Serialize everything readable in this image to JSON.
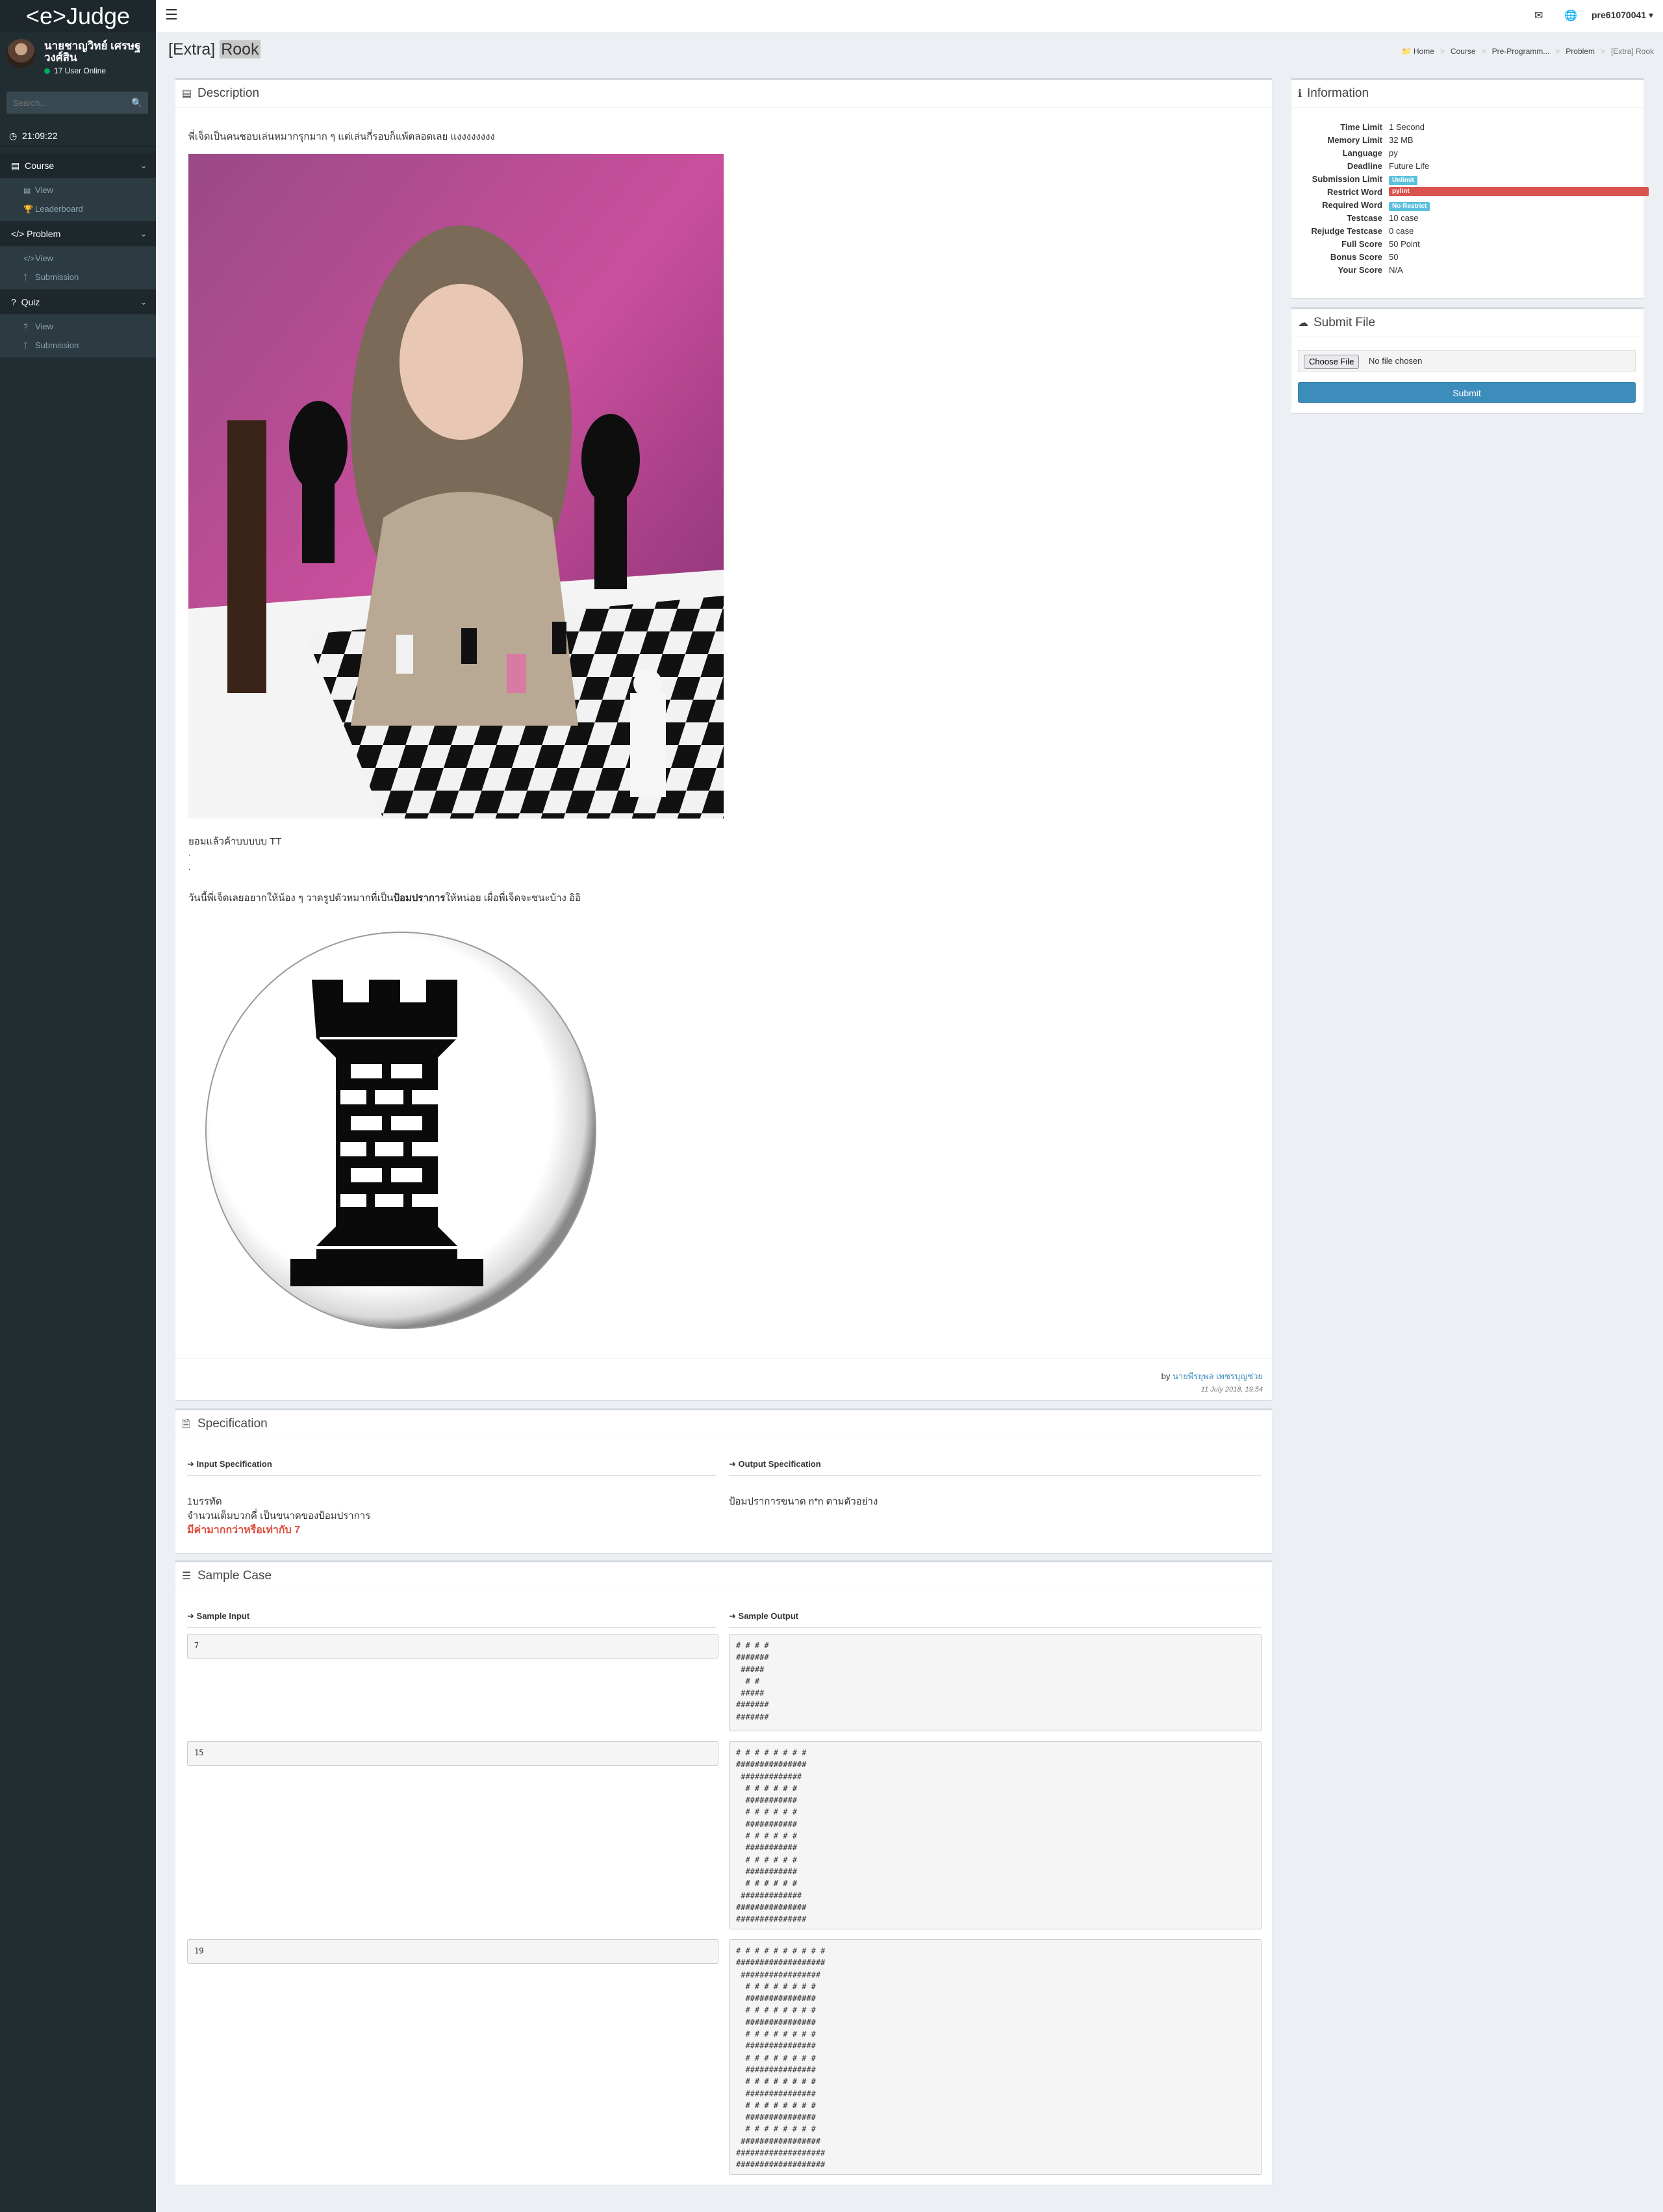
{
  "sidebar": {
    "brand": "<e>Judge",
    "user_name": "นายชาญวิทย์ เศรษฐวงศ์สิน",
    "online": "17 User Online",
    "search_placeholder": "Search...",
    "clock": "21:09:22",
    "sections": [
      {
        "label": "Course",
        "items": [
          {
            "label": "View"
          },
          {
            "label": "Leaderboard"
          }
        ]
      },
      {
        "label": "Problem",
        "items": [
          {
            "label": "View"
          },
          {
            "label": "Submission"
          }
        ]
      },
      {
        "label": "Quiz",
        "items": [
          {
            "label": "View"
          },
          {
            "label": "Submission"
          }
        ]
      }
    ]
  },
  "navbar": {
    "user": "pre61070041"
  },
  "page": {
    "title_prefix": "[Extra]",
    "title_highlight": "Rook"
  },
  "breadcrumb": [
    "Home",
    "Course",
    "Pre-Programm...",
    "Problem",
    "[Extra] Rook"
  ],
  "description": {
    "title": "Description",
    "p1": "พี่เจ็ดเป็นคนชอบเล่นหมากรุกมาก ๆ แต่เล่นกี่รอบก็แพ้ตลอดเลย แงงงงงงงง",
    "p2": "ยอมแล้วค้าบบบบบ TT",
    "dot1": ".",
    "dot2": ".",
    "p3_before": "วันนี้พี่เจ็ดเลยอยากให้น้อง ๆ วาดรูปตัวหมากที่เป็น",
    "p3_bold": "ป้อมปราการ",
    "p3_after": "ให้หน่อย เผื่อพี่เจ็ดจะชนะบ้าง อิอิ",
    "author_by": "by",
    "author_name": "นายพีรยุพล เพชรบุญช่วย",
    "date": "11 July 2018, 19:54"
  },
  "specification": {
    "title": "Specification",
    "input_title": "Input Specification",
    "output_title": "Output Specification",
    "input_line1": "1บรรทัด",
    "input_line2": "จำนวนเต็มบวกคี่ เป็นขนาดของป้อมปราการ",
    "input_line3": "มีค่ามากกว่าหรือเท่ากับ 7",
    "output_line1": "ป้อมปราการขนาด n*n ตามตัวอย่าง"
  },
  "samples": {
    "title": "Sample Case",
    "input_title": "Sample Input",
    "output_title": "Sample Output",
    "cases": [
      {
        "input": "7",
        "output": "# # # #\n#######\n #####\n  # #\n #####\n#######\n#######"
      },
      {
        "input": "15",
        "output": "# # # # # # # #\n###############\n #############\n  # # # # # #\n  ###########\n  # # # # # #\n  ###########\n  # # # # # #\n  ###########\n  # # # # # #\n  ###########\n  # # # # # #\n #############\n###############\n###############"
      },
      {
        "input": "19",
        "output": "# # # # # # # # # #\n###################\n #################\n  # # # # # # # #\n  ###############\n  # # # # # # # #\n  ###############\n  # # # # # # # #\n  ###############\n  # # # # # # # #\n  ###############\n  # # # # # # # #\n  ###############\n  # # # # # # # #\n  ###############\n  # # # # # # # #\n #################\n###################\n###################"
      }
    ]
  },
  "information": {
    "title": "Information",
    "rows": [
      {
        "key": "Time Limit",
        "value": "1 Second"
      },
      {
        "key": "Memory Limit",
        "value": "32 MB"
      },
      {
        "key": "Language",
        "value": "py"
      },
      {
        "key": "Deadline",
        "value": "Future Life"
      },
      {
        "key": "Submission Limit",
        "badge": "Unlimit"
      },
      {
        "key": "Restrict Word",
        "badge": "pylint"
      },
      {
        "key": "Required Word",
        "badge": "No Restrict"
      },
      {
        "key": "Testcase",
        "value": "10 case"
      },
      {
        "key": "Rejudge Testcase",
        "value": "0 case"
      },
      {
        "key": "Full Score",
        "value": "50 Point"
      },
      {
        "key": "Bonus Score",
        "value": "50"
      },
      {
        "key": "Your Score",
        "value": "N/A"
      }
    ]
  },
  "submit": {
    "title": "Submit File",
    "choose_file": "Choose File",
    "no_file": "No file chosen",
    "submit_label": "Submit"
  },
  "colors": {
    "sidebar": "#222d32",
    "accent": "#3c8dbc",
    "danger": "#dd4b39",
    "badge_blue": "#5bc0de",
    "badge_red": "#d9534f"
  }
}
